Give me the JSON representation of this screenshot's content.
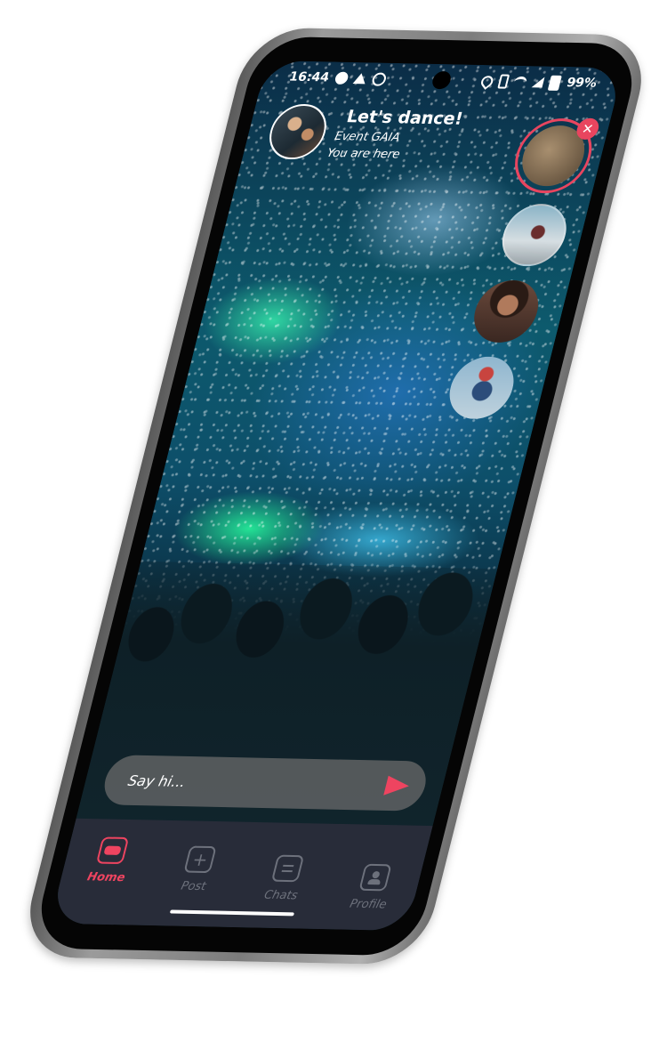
{
  "status_bar": {
    "time": "16:44",
    "battery": "99%"
  },
  "event": {
    "title": "Let's dance!",
    "name": "Event GAIA",
    "location": "You are here"
  },
  "stories": {
    "close_label": "✕"
  },
  "message": {
    "placeholder": "Say hi..."
  },
  "nav": {
    "items": [
      {
        "label": "Home",
        "icon": "home-icon",
        "active": true
      },
      {
        "label": "Post",
        "icon": "plus-icon",
        "active": false
      },
      {
        "label": "Chats",
        "icon": "chat-icon",
        "active": false
      },
      {
        "label": "Profile",
        "icon": "profile-icon",
        "active": false
      }
    ],
    "plus_glyph": "+"
  },
  "colors": {
    "accent": "#ee4460",
    "nav_bg": "#282c39",
    "nav_inactive": "#6d717c"
  }
}
